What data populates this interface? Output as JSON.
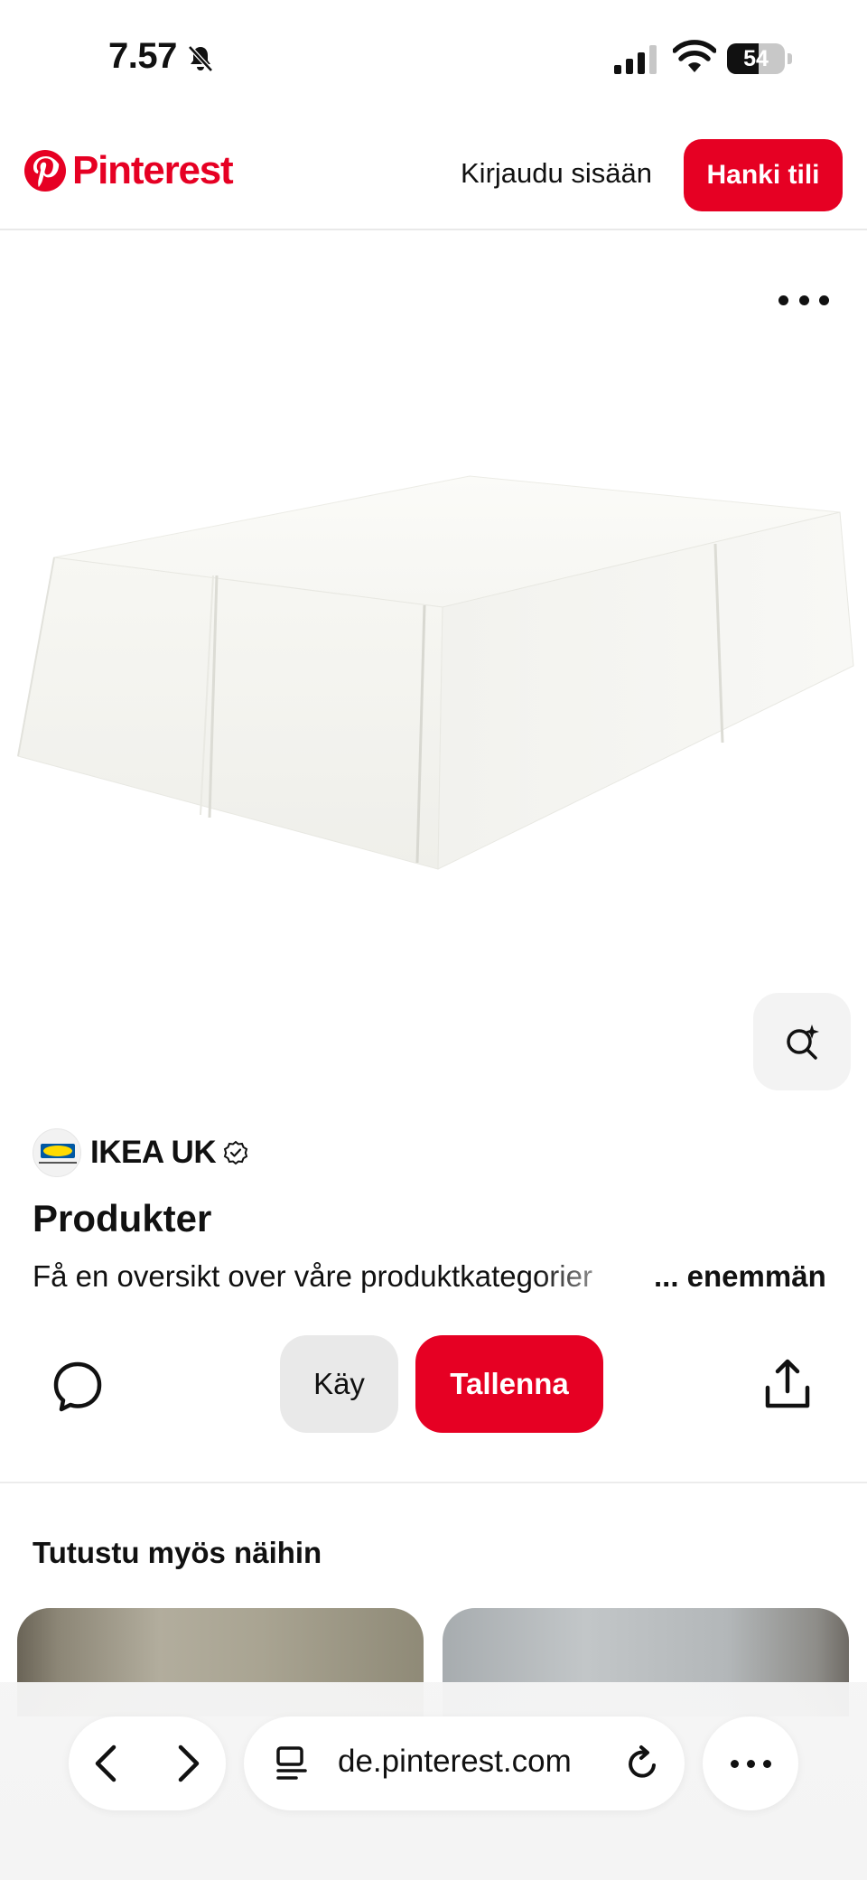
{
  "status_bar": {
    "time": "7.57",
    "battery_level": 54,
    "battery_label": "54",
    "icons": [
      "bell-slash-icon",
      "cellular-signal-icon",
      "wifi-icon",
      "battery-icon"
    ]
  },
  "header": {
    "logo_text": "Pinterest",
    "login_label": "Kirjaudu sisään",
    "signup_label": "Hanki tili",
    "brand_color": "#e60023"
  },
  "pin": {
    "image_subject": "bed-valance-white",
    "creator_name": "IKEA UK",
    "creator_verified": true,
    "title": "Produkter",
    "description": "Få en oversikt over våre produktkategorier",
    "more_label": "... enemmän"
  },
  "actions": {
    "visit_label": "Käy",
    "save_label": "Tallenna",
    "icons": [
      "comment-icon",
      "share-icon",
      "visual-search-icon",
      "more-icon"
    ]
  },
  "related": {
    "title": "Tutustu myös näihin"
  },
  "browser": {
    "url": "de.pinterest.com",
    "icons": [
      "back-icon",
      "forward-icon",
      "reader-icon",
      "reload-icon",
      "more-icon"
    ]
  },
  "colors": {
    "accent": "#e60023",
    "secondary_button": "#e9e9e9",
    "text": "#111111"
  }
}
